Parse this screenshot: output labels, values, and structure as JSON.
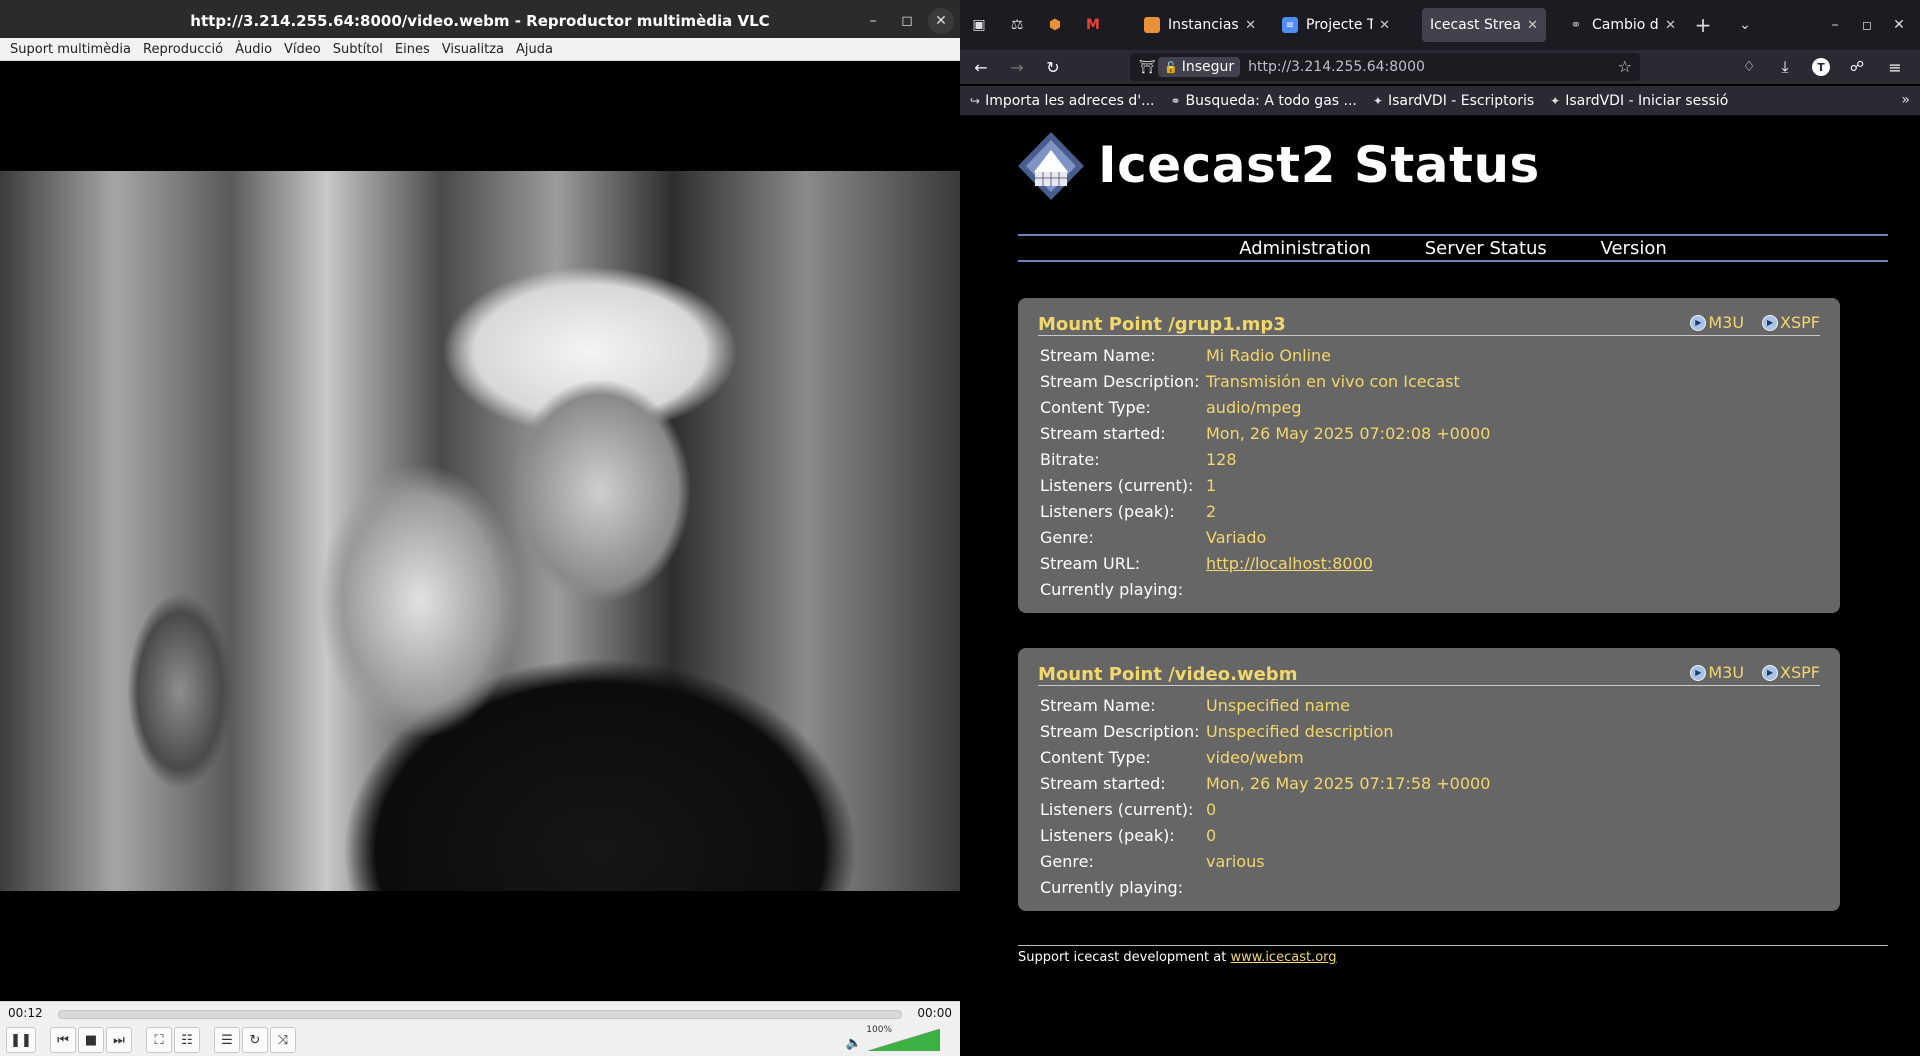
{
  "vlc": {
    "window_title": "http://3.214.255.64:8000/video.webm - Reproductor multimèdia VLC",
    "menu": [
      "Suport multimèdia",
      "Reproducció",
      "Àudio",
      "Vídeo",
      "Subtítol",
      "Eines",
      "Visualitza",
      "Ajuda"
    ],
    "time_current": "00:12",
    "time_total": "00:00",
    "seek_progress": 0,
    "volume_label": "100%",
    "volume_level": 1.0
  },
  "firefox": {
    "tabs": [
      {
        "label": "Instancias | E",
        "icon": "aws-icon",
        "color": "#e8913a"
      },
      {
        "label": "Projecte Tra",
        "icon": "docs-icon",
        "color": "#4f8ef7"
      },
      {
        "label": "Icecast Streami",
        "icon": "none",
        "color": "#42414d",
        "active": true
      },
      {
        "label": "Cambio de n",
        "icon": "globe-icon",
        "color": "#aaaaaa"
      }
    ],
    "url_security_label": "Insegur",
    "url": "http://3.214.255.64:8000",
    "bookmarks": [
      {
        "label": "Importa les adreces d'...",
        "icon": "import-icon"
      },
      {
        "label": "Busqueda: A todo gas ...",
        "icon": "globe-icon"
      },
      {
        "label": "IsardVDI - Escriptoris",
        "icon": "isard-icon"
      },
      {
        "label": "IsardVDI - Iniciar sessió",
        "icon": "isard-icon"
      }
    ]
  },
  "icecast": {
    "title": "Icecast2 Status",
    "nav": [
      "Administration",
      "Server Status",
      "Version"
    ],
    "m3u_label": "M3U",
    "xspf_label": "XSPF",
    "mounts": [
      {
        "title": "Mount Point /grup1.mp3",
        "rows": [
          {
            "k": "Stream Name:",
            "v": "Mi Radio Online"
          },
          {
            "k": "Stream Description:",
            "v": "Transmisión en vivo con Icecast"
          },
          {
            "k": "Content Type:",
            "v": "audio/mpeg"
          },
          {
            "k": "Stream started:",
            "v": "Mon, 26 May 2025 07:02:08 +0000"
          },
          {
            "k": "Bitrate:",
            "v": "128"
          },
          {
            "k": "Listeners (current):",
            "v": "1"
          },
          {
            "k": "Listeners (peak):",
            "v": "2"
          },
          {
            "k": "Genre:",
            "v": "Variado"
          },
          {
            "k": "Stream URL:",
            "v": "http://localhost:8000"
          },
          {
            "k": "Currently playing:",
            "v": ""
          }
        ]
      },
      {
        "title": "Mount Point /video.webm",
        "rows": [
          {
            "k": "Stream Name:",
            "v": "Unspecified name"
          },
          {
            "k": "Stream Description:",
            "v": "Unspecified description"
          },
          {
            "k": "Content Type:",
            "v": "video/webm"
          },
          {
            "k": "Stream started:",
            "v": "Mon, 26 May 2025 07:17:58 +0000"
          },
          {
            "k": "Listeners (current):",
            "v": "0"
          },
          {
            "k": "Listeners (peak):",
            "v": "0"
          },
          {
            "k": "Genre:",
            "v": "various"
          },
          {
            "k": "Currently playing:",
            "v": ""
          }
        ]
      }
    ],
    "footer_text": "Support icecast development at ",
    "footer_link": "www.icecast.org",
    "colors": {
      "accent": "#f2d76b",
      "panel": "#666666",
      "rule": "#6c84b7"
    }
  }
}
